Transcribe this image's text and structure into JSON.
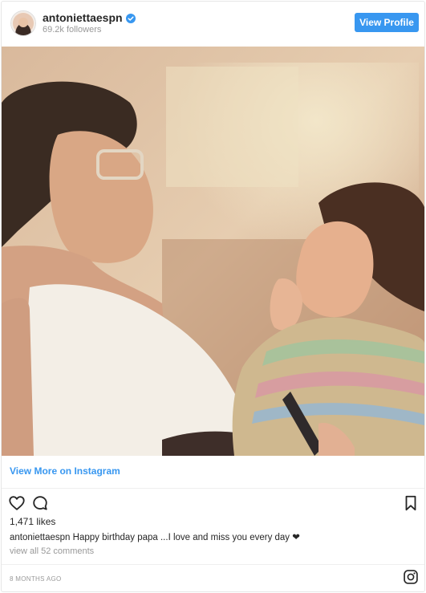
{
  "header": {
    "username": "antoniettaespn",
    "followers": "69.2k followers",
    "view_profile_label": "View Profile",
    "verified_icon": "verified-badge-icon"
  },
  "photo": {
    "description_icon": "post-photo"
  },
  "links": {
    "view_more_label": "View More on Instagram"
  },
  "actions": {
    "like_icon": "heart-icon",
    "comment_icon": "comment-icon",
    "save_icon": "bookmark-icon"
  },
  "post": {
    "likes": "1,471 likes",
    "caption_user": "antoniettaespn",
    "caption_text": "Happy birthday papa ...I love and miss you every day ❤",
    "comments_link": "view all 52 comments",
    "time_ago": "8 MONTHS AGO"
  },
  "colors": {
    "accent": "#3897f0",
    "muted": "#999999",
    "text": "#262626"
  }
}
